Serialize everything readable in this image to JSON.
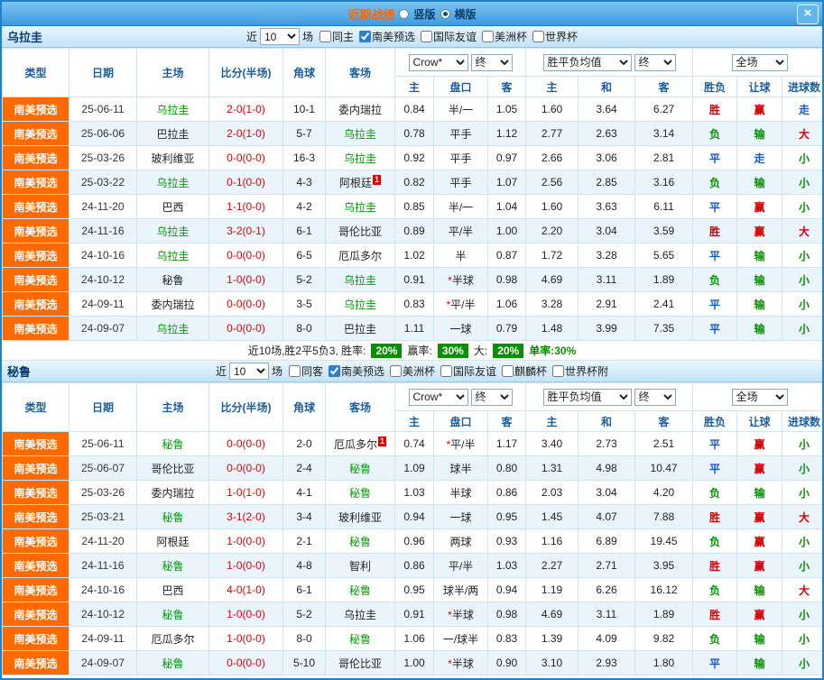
{
  "header": {
    "title": "近期战绩",
    "layout_options": [
      {
        "label": "竖版",
        "selected": false
      },
      {
        "label": "横版",
        "selected": true
      }
    ],
    "close_label": "×"
  },
  "table": {
    "col_type": "类型",
    "col_date": "日期",
    "col_home": "主场",
    "col_score": "比分(半场)",
    "col_corner": "角球",
    "col_away": "客场",
    "odds_company_select": "Crow*",
    "odds_final_select": "终",
    "sub_home": "主",
    "sub_line": "盘口",
    "sub_away": "客",
    "euro_select": "胜平负均值",
    "euro_final_select": "终",
    "sub_euro_home": "主",
    "sub_euro_draw": "和",
    "sub_euro_away": "客",
    "fulltime_select": "全场",
    "sub_result": "胜负",
    "sub_handicap": "让球",
    "sub_goals": "进球数"
  },
  "sections": [
    {
      "team": "乌拉圭",
      "filter": {
        "near_label": "近",
        "count": "10",
        "games_label": "场",
        "options": [
          {
            "label": "同主",
            "checked": false
          },
          {
            "label": "南美预选",
            "checked": true
          },
          {
            "label": "国际友谊",
            "checked": false
          },
          {
            "label": "美洲杯",
            "checked": false
          },
          {
            "label": "世界杯",
            "checked": false
          }
        ]
      },
      "rows": [
        {
          "type": "南美预选",
          "date": "25-06-11",
          "home": "乌拉圭",
          "home_hl": true,
          "score": "2-0(1-0)",
          "corner": "10-1",
          "away": "委内瑞拉",
          "away_hl": false,
          "odds": [
            "0.84",
            "半/一",
            "1.05"
          ],
          "euro": [
            "1.60",
            "3.64",
            "6.27"
          ],
          "marks": [
            "胜",
            "赢",
            "走"
          ]
        },
        {
          "type": "南美预选",
          "date": "25-06-06",
          "home": "巴拉圭",
          "home_hl": false,
          "score": "2-0(1-0)",
          "corner": "5-7",
          "away": "乌拉圭",
          "away_hl": true,
          "odds": [
            "0.78",
            "平手",
            "1.12"
          ],
          "euro": [
            "2.77",
            "2.63",
            "3.14"
          ],
          "marks": [
            "负",
            "输",
            "大"
          ]
        },
        {
          "type": "南美预选",
          "date": "25-03-26",
          "home": "玻利维亚",
          "home_hl": false,
          "score": "0-0(0-0)",
          "corner": "16-3",
          "away": "乌拉圭",
          "away_hl": true,
          "odds": [
            "0.92",
            "平手",
            "0.97"
          ],
          "euro": [
            "2.66",
            "3.06",
            "2.81"
          ],
          "marks": [
            "平",
            "走",
            "小"
          ]
        },
        {
          "type": "南美预选",
          "date": "25-03-22",
          "home": "乌拉圭",
          "home_hl": true,
          "score": "0-1(0-0)",
          "corner": "4-3",
          "away": "阿根廷",
          "away_hl": false,
          "away_badge": "1",
          "odds": [
            "0.82",
            "平手",
            "1.07"
          ],
          "euro": [
            "2.56",
            "2.85",
            "3.16"
          ],
          "marks": [
            "负",
            "输",
            "小"
          ]
        },
        {
          "type": "南美预选",
          "date": "24-11-20",
          "home": "巴西",
          "home_hl": false,
          "score": "1-1(0-0)",
          "corner": "4-2",
          "away": "乌拉圭",
          "away_hl": true,
          "odds": [
            "0.85",
            "半/一",
            "1.04"
          ],
          "euro": [
            "1.60",
            "3.63",
            "6.11"
          ],
          "marks": [
            "平",
            "赢",
            "小"
          ]
        },
        {
          "type": "南美预选",
          "date": "24-11-16",
          "home": "乌拉圭",
          "home_hl": true,
          "score": "3-2(0-1)",
          "corner": "6-1",
          "away": "哥伦比亚",
          "away_hl": false,
          "odds": [
            "0.89",
            "平/半",
            "1.00"
          ],
          "euro": [
            "2.20",
            "3.04",
            "3.59"
          ],
          "marks": [
            "胜",
            "赢",
            "大"
          ]
        },
        {
          "type": "南美预选",
          "date": "24-10-16",
          "home": "乌拉圭",
          "home_hl": true,
          "score": "0-0(0-0)",
          "corner": "6-5",
          "away": "厄瓜多尔",
          "away_hl": false,
          "odds": [
            "1.02",
            "半",
            "0.87"
          ],
          "euro": [
            "1.72",
            "3.28",
            "5.65"
          ],
          "marks": [
            "平",
            "输",
            "小"
          ]
        },
        {
          "type": "南美预选",
          "date": "24-10-12",
          "home": "秘鲁",
          "home_hl": false,
          "score": "1-0(0-0)",
          "corner": "5-2",
          "away": "乌拉圭",
          "away_hl": true,
          "odds": [
            "0.91",
            "*半球",
            "0.98"
          ],
          "euro": [
            "4.69",
            "3.11",
            "1.89"
          ],
          "marks": [
            "负",
            "输",
            "小"
          ]
        },
        {
          "type": "南美预选",
          "date": "24-09-11",
          "home": "委内瑞拉",
          "home_hl": false,
          "score": "0-0(0-0)",
          "corner": "3-5",
          "away": "乌拉圭",
          "away_hl": true,
          "odds": [
            "0.83",
            "*平/半",
            "1.06"
          ],
          "euro": [
            "3.28",
            "2.91",
            "2.41"
          ],
          "marks": [
            "平",
            "输",
            "小"
          ]
        },
        {
          "type": "南美预选",
          "date": "24-09-07",
          "home": "乌拉圭",
          "home_hl": true,
          "score": "0-0(0-0)",
          "corner": "8-0",
          "away": "巴拉圭",
          "away_hl": false,
          "odds": [
            "1.11",
            "一球",
            "0.79"
          ],
          "euro": [
            "1.48",
            "3.99",
            "7.35"
          ],
          "marks": [
            "平",
            "输",
            "小"
          ]
        }
      ],
      "summary": {
        "text": "近10场,胜2平5负3, 胜率:",
        "win_rate": "20%",
        "handicap_label": "赢率:",
        "handicap_rate": "30%",
        "big_label": "大:",
        "big_rate": "20%",
        "single_rate": "单率:30%"
      }
    },
    {
      "team": "秘鲁",
      "filter": {
        "near_label": "近",
        "count": "10",
        "games_label": "场",
        "options": [
          {
            "label": "同客",
            "checked": false
          },
          {
            "label": "南美预选",
            "checked": true
          },
          {
            "label": "美洲杯",
            "checked": false
          },
          {
            "label": "国际友谊",
            "checked": false
          },
          {
            "label": "麒麟杯",
            "checked": false
          },
          {
            "label": "世界杯附",
            "checked": false
          }
        ]
      },
      "rows": [
        {
          "type": "南美预选",
          "date": "25-06-11",
          "home": "秘鲁",
          "home_hl": true,
          "score": "0-0(0-0)",
          "corner": "2-0",
          "away": "厄瓜多尔",
          "away_hl": false,
          "away_badge": "1",
          "odds": [
            "0.74",
            "*平/半",
            "1.17"
          ],
          "euro": [
            "3.40",
            "2.73",
            "2.51"
          ],
          "marks": [
            "平",
            "赢",
            "小"
          ]
        },
        {
          "type": "南美预选",
          "date": "25-06-07",
          "home": "哥伦比亚",
          "home_hl": false,
          "score": "0-0(0-0)",
          "corner": "2-4",
          "away": "秘鲁",
          "away_hl": true,
          "odds": [
            "1.09",
            "球半",
            "0.80"
          ],
          "euro": [
            "1.31",
            "4.98",
            "10.47"
          ],
          "marks": [
            "平",
            "赢",
            "小"
          ]
        },
        {
          "type": "南美预选",
          "date": "25-03-26",
          "home": "委内瑞拉",
          "home_hl": false,
          "score": "1-0(1-0)",
          "corner": "4-1",
          "away": "秘鲁",
          "away_hl": true,
          "odds": [
            "1.03",
            "半球",
            "0.86"
          ],
          "euro": [
            "2.03",
            "3.04",
            "4.20"
          ],
          "marks": [
            "负",
            "输",
            "小"
          ]
        },
        {
          "type": "南美预选",
          "date": "25-03-21",
          "home": "秘鲁",
          "home_hl": true,
          "score": "3-1(2-0)",
          "corner": "3-4",
          "away": "玻利维亚",
          "away_hl": false,
          "odds": [
            "0.94",
            "一球",
            "0.95"
          ],
          "euro": [
            "1.45",
            "4.07",
            "7.88"
          ],
          "marks": [
            "胜",
            "赢",
            "大"
          ]
        },
        {
          "type": "南美预选",
          "date": "24-11-20",
          "home": "阿根廷",
          "home_hl": false,
          "score": "1-0(0-0)",
          "corner": "2-1",
          "away": "秘鲁",
          "away_hl": true,
          "odds": [
            "0.96",
            "两球",
            "0.93"
          ],
          "euro": [
            "1.16",
            "6.89",
            "19.45"
          ],
          "marks": [
            "负",
            "赢",
            "小"
          ]
        },
        {
          "type": "南美预选",
          "date": "24-11-16",
          "home": "秘鲁",
          "home_hl": true,
          "score": "1-0(0-0)",
          "corner": "4-8",
          "away": "智利",
          "away_hl": false,
          "odds": [
            "0.86",
            "平/半",
            "1.03"
          ],
          "euro": [
            "2.27",
            "2.71",
            "3.95"
          ],
          "marks": [
            "胜",
            "赢",
            "小"
          ]
        },
        {
          "type": "南美预选",
          "date": "24-10-16",
          "home": "巴西",
          "home_hl": false,
          "score": "4-0(1-0)",
          "corner": "6-1",
          "away": "秘鲁",
          "away_hl": true,
          "odds": [
            "0.95",
            "球半/两",
            "0.94"
          ],
          "euro": [
            "1.19",
            "6.26",
            "16.12"
          ],
          "marks": [
            "负",
            "输",
            "大"
          ]
        },
        {
          "type": "南美预选",
          "date": "24-10-12",
          "home": "秘鲁",
          "home_hl": true,
          "score": "1-0(0-0)",
          "corner": "5-2",
          "away": "乌拉圭",
          "away_hl": false,
          "odds": [
            "0.91",
            "*半球",
            "0.98"
          ],
          "euro": [
            "4.69",
            "3.11",
            "1.89"
          ],
          "marks": [
            "胜",
            "赢",
            "小"
          ]
        },
        {
          "type": "南美预选",
          "date": "24-09-11",
          "home": "厄瓜多尔",
          "home_hl": false,
          "score": "1-0(0-0)",
          "corner": "8-0",
          "away": "秘鲁",
          "away_hl": true,
          "odds": [
            "1.06",
            "一/球半",
            "0.83"
          ],
          "euro": [
            "1.39",
            "4.09",
            "9.82"
          ],
          "marks": [
            "负",
            "输",
            "小"
          ]
        },
        {
          "type": "南美预选",
          "date": "24-09-07",
          "home": "秘鲁",
          "home_hl": true,
          "score": "0-0(0-0)",
          "corner": "5-10",
          "away": "哥伦比亚",
          "away_hl": false,
          "odds": [
            "1.00",
            "*半球",
            "0.90"
          ],
          "euro": [
            "3.10",
            "2.93",
            "1.80"
          ],
          "marks": [
            "平",
            "输",
            "小"
          ]
        }
      ]
    }
  ]
}
